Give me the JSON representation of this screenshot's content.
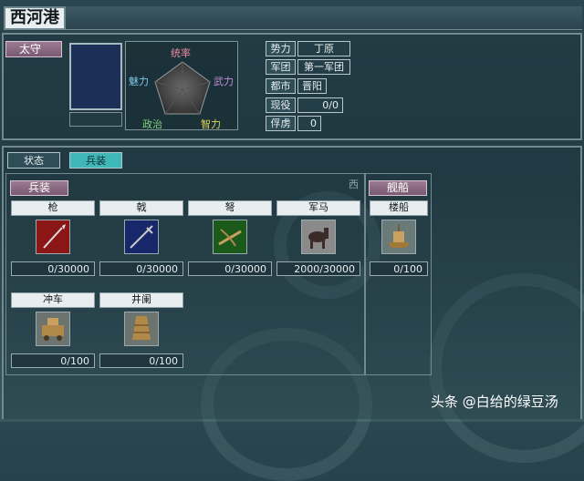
{
  "city_name": "西河港",
  "prefect_label": "太守",
  "stats": {
    "leadership": "统率",
    "war": "武力",
    "intelligence": "智力",
    "politics": "政治",
    "charm": "魅力"
  },
  "info": [
    {
      "label": "势力",
      "value": "丁原"
    },
    {
      "label": "军团",
      "value": "第一军团"
    },
    {
      "label": "都市",
      "value": "晋阳"
    },
    {
      "label": "现役",
      "value": "0/0"
    },
    {
      "label": "俘虏",
      "value": "0"
    }
  ],
  "tabs": [
    {
      "label": "状态"
    },
    {
      "label": "兵装"
    }
  ],
  "active_tab": "兵装",
  "weapons_title": "兵装",
  "ghost_text": "西",
  "weapons": [
    {
      "name": "枪",
      "icon": "spear-icon",
      "count": "0/30000"
    },
    {
      "name": "戟",
      "icon": "halberd-icon",
      "count": "0/30000"
    },
    {
      "name": "弩",
      "icon": "crossbow-icon",
      "count": "0/30000"
    },
    {
      "name": "军马",
      "icon": "horse-icon",
      "count": "2000/30000"
    },
    {
      "name": "冲车",
      "icon": "battering-ram-icon",
      "count": "0/100"
    },
    {
      "name": "井阑",
      "icon": "siege-tower-icon",
      "count": "0/100"
    }
  ],
  "ships_title": "舰船",
  "ships": [
    {
      "name": "楼船",
      "icon": "tower-ship-icon",
      "count": "0/100"
    }
  ],
  "watermark": "头条 @白给的绿豆汤",
  "colors": {
    "pink_label": "#9b7b92",
    "active_tab": "#3fb7b9",
    "spear_bg": "#8a1616",
    "halberd_bg": "#16286a",
    "crossbow_bg": "#1c5a1c"
  }
}
